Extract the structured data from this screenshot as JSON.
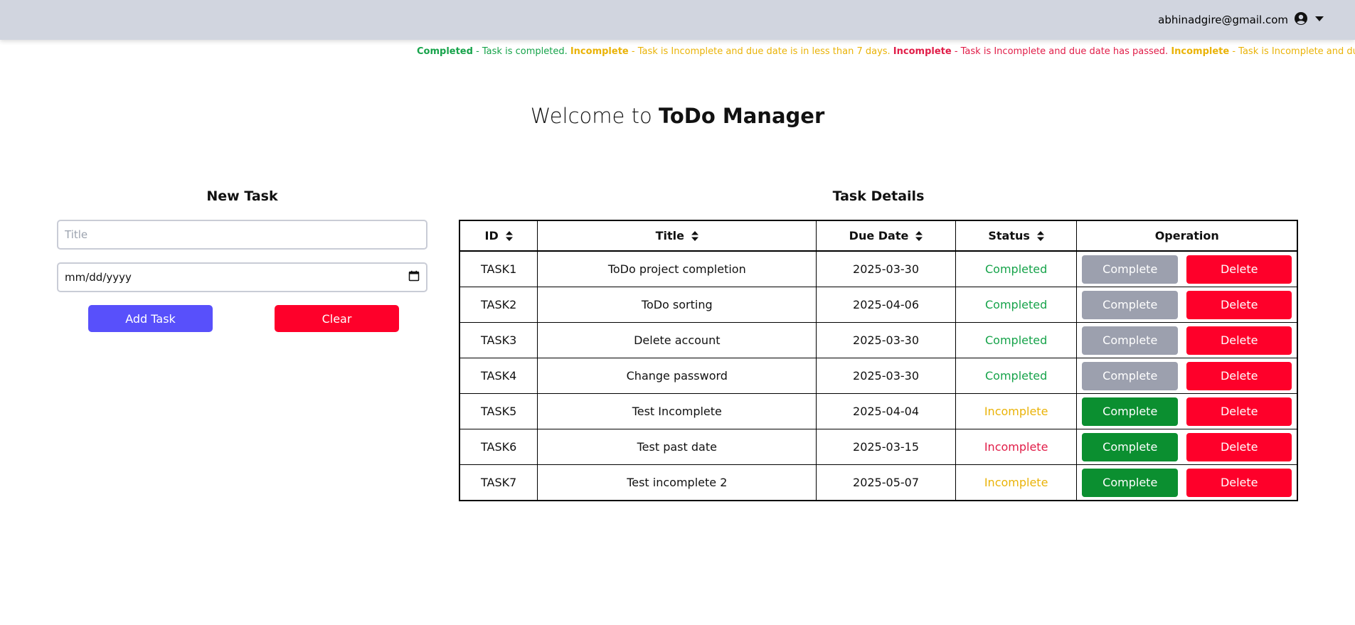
{
  "header": {
    "user_email": "abhinadgire@gmail.com",
    "user_icon": "user-circle-icon",
    "menu_icon": "caret-down-icon"
  },
  "legend": [
    {
      "label": "Completed",
      "text": " - Task is completed. ",
      "color": "#16a34a"
    },
    {
      "label": "Incomplete",
      "text": " - Task is Incomplete and due date is in less than 7 days. ",
      "color": "#eab308"
    },
    {
      "label": "Incomplete",
      "text": " - Task is Incomplete and due date has passed. ",
      "color": "#e11d48"
    },
    {
      "label": "Incomplete",
      "text": " - Task is Incomplete and due date is more",
      "color": "#eab308"
    }
  ],
  "welcome": {
    "prefix": "Welcome to ",
    "app_name": "ToDo Manager"
  },
  "new_task": {
    "heading": "New Task",
    "title_placeholder": "Title",
    "date_value": "mm/dd/yyyy",
    "add_label": "Add Task",
    "clear_label": "Clear"
  },
  "task_details": {
    "heading": "Task Details",
    "columns": [
      "ID",
      "Title",
      "Due Date",
      "Status",
      "Operation"
    ],
    "complete_label": "Complete",
    "delete_label": "Delete",
    "rows": [
      {
        "id": "TASK1",
        "title": "ToDo project completion",
        "due": "2025-03-30",
        "status": "Completed",
        "status_color": "#16a34a",
        "complete_enabled": false
      },
      {
        "id": "TASK2",
        "title": "ToDo sorting",
        "due": "2025-04-06",
        "status": "Completed",
        "status_color": "#16a34a",
        "complete_enabled": false
      },
      {
        "id": "TASK3",
        "title": "Delete account",
        "due": "2025-03-30",
        "status": "Completed",
        "status_color": "#16a34a",
        "complete_enabled": false
      },
      {
        "id": "TASK4",
        "title": "Change password",
        "due": "2025-03-30",
        "status": "Completed",
        "status_color": "#16a34a",
        "complete_enabled": false
      },
      {
        "id": "TASK5",
        "title": "Test Incomplete",
        "due": "2025-04-04",
        "status": "Incomplete",
        "status_color": "#eab308",
        "complete_enabled": true
      },
      {
        "id": "TASK6",
        "title": "Test past date",
        "due": "2025-03-15",
        "status": "Incomplete",
        "status_color": "#e11d48",
        "complete_enabled": true
      },
      {
        "id": "TASK7",
        "title": "Test incomplete 2",
        "due": "2025-05-07",
        "status": "Incomplete",
        "status_color": "#eab308",
        "complete_enabled": true
      }
    ]
  }
}
